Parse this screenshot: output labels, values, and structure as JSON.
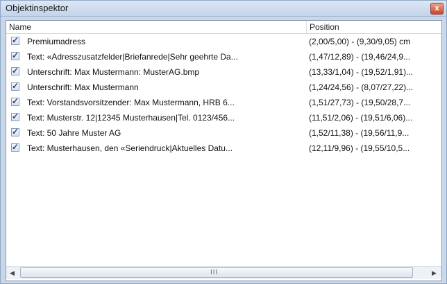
{
  "window": {
    "title": "Objektinspektor",
    "close_glyph": "x"
  },
  "columns": {
    "name": "Name",
    "position": "Position"
  },
  "rows": [
    {
      "checked": true,
      "name": "Premiumadress",
      "position": "(2,00/5,00) - (9,30/9,05) cm"
    },
    {
      "checked": true,
      "name": "Text: «Adresszusatzfelder|Briefanrede|Sehr geehrte Da...",
      "position": "(1,47/12,89) - (19,46/24,9..."
    },
    {
      "checked": true,
      "name": "Unterschrift: Max Mustermann: MusterAG.bmp",
      "position": "(13,33/1,04) - (19,52/1,91)..."
    },
    {
      "checked": true,
      "name": "Unterschrift: Max Mustermann",
      "position": "(1,24/24,56) - (8,07/27,22)..."
    },
    {
      "checked": true,
      "name": "Text: Vorstandsvorsitzender: Max Mustermann, HRB 6...",
      "position": "(1,51/27,73) - (19,50/28,7..."
    },
    {
      "checked": true,
      "name": "Text: Musterstr. 12|12345 Musterhausen|Tel. 0123/456...",
      "position": "(11,51/2,06) - (19,51/6,06)..."
    },
    {
      "checked": true,
      "name": "Text: 50 Jahre Muster AG",
      "position": "(1,52/11,38) - (19,56/11,9..."
    },
    {
      "checked": true,
      "name": "Text: Musterhausen, den «Seriendruck|Aktuelles Datu...",
      "position": "(12,11/9,96) - (19,55/10,5..."
    }
  ],
  "scrollbar": {
    "left_glyph": "◀",
    "right_glyph": "▶",
    "grip_glyph": "III"
  },
  "colors": {
    "check": "#2a3f8e",
    "close": "#c9452b"
  }
}
